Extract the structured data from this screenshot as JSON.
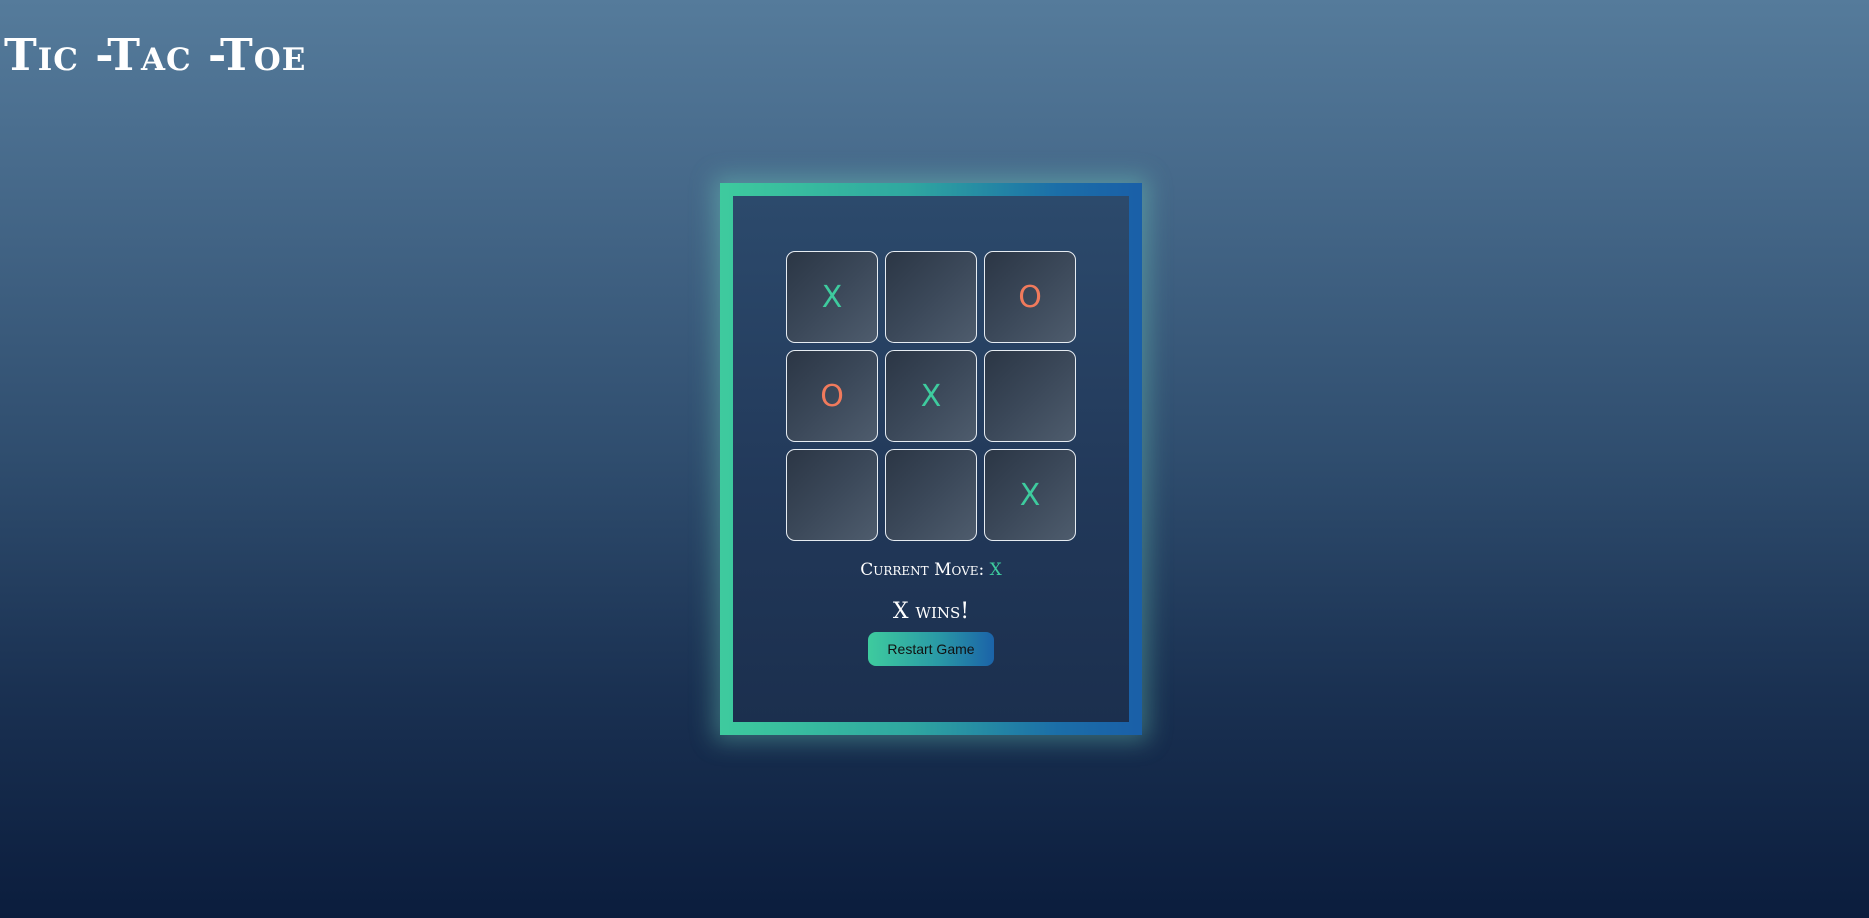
{
  "header": {
    "title": "Tic -Tac -Toe"
  },
  "board": {
    "cells": [
      "X",
      "",
      "O",
      "O",
      "X",
      "",
      "",
      "",
      "X"
    ]
  },
  "status": {
    "current_move_label": "Current Move:",
    "current_move_value": "X",
    "result_text": "X wins!"
  },
  "controls": {
    "restart_label": "Restart Game"
  },
  "colors": {
    "x_mark": "#3ecb9e",
    "o_mark": "#f07a5c",
    "frame_start": "#3ecb9e",
    "frame_end": "#1a5fa8"
  }
}
